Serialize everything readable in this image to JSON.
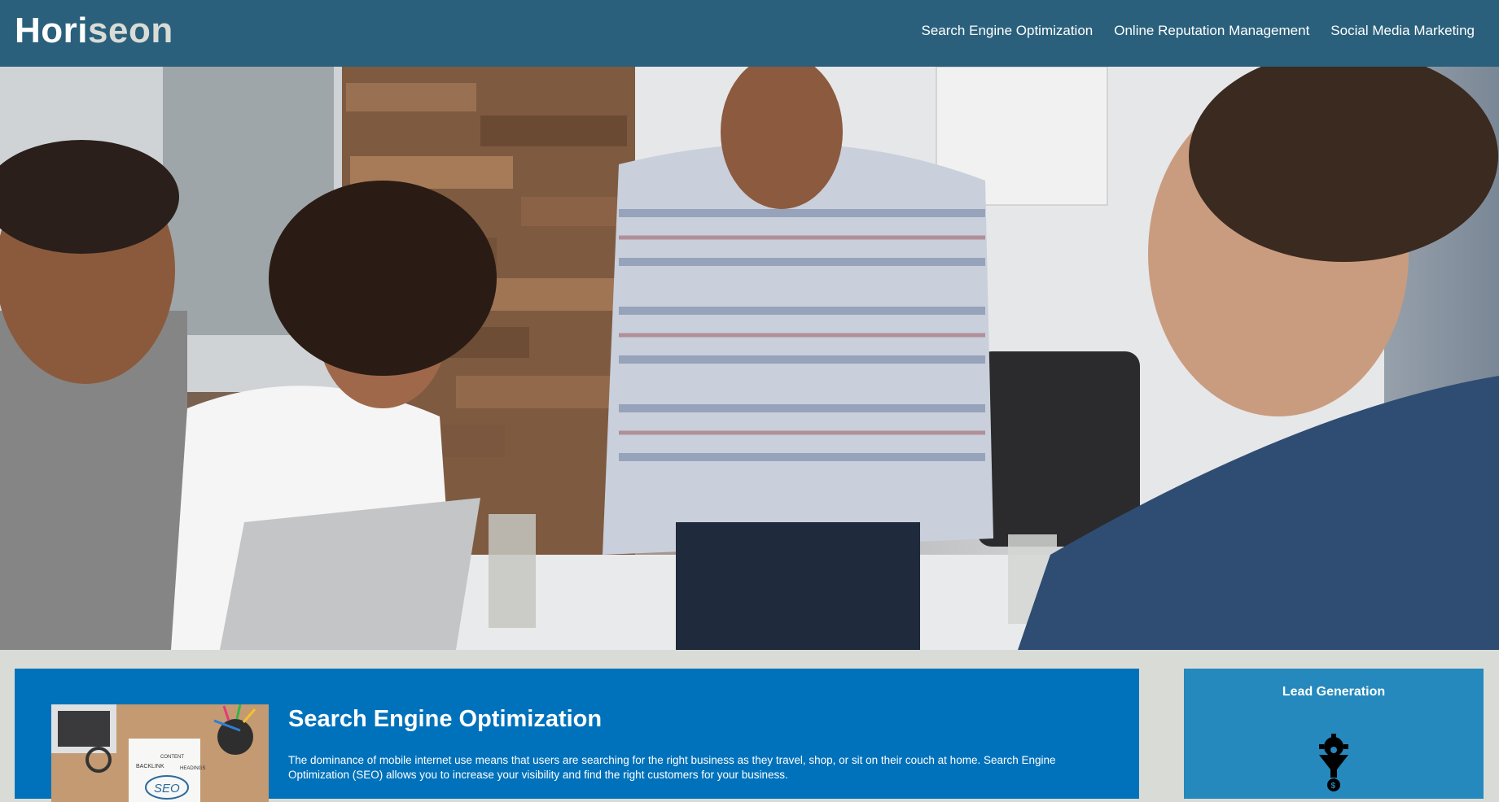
{
  "header": {
    "logo_main": "Hori",
    "logo_accent": "seon",
    "nav": [
      {
        "label": "Search Engine Optimization"
      },
      {
        "label": "Online Reputation Management"
      },
      {
        "label": "Social Media Marketing"
      }
    ]
  },
  "content": {
    "title": "Search Engine Optimization",
    "body": "The dominance of mobile internet use means that users are searching for the right business as they travel, shop, or sit on their couch at home. Search Engine Optimization (SEO) allows you to increase your visibility and find the right customers for your business.",
    "thumb_labels": {
      "backlink": "BACKLINK",
      "content": "CONTENT",
      "headings": "HEADINGS",
      "seo": "SEO"
    }
  },
  "sidebar": {
    "title": "Lead Generation",
    "icon": "lead-generation-icon"
  },
  "colors": {
    "header_bg": "#2a607c",
    "content_bg": "#0072bb",
    "sidebar_bg": "#2589bd",
    "page_bg": "#d9dcd6"
  }
}
